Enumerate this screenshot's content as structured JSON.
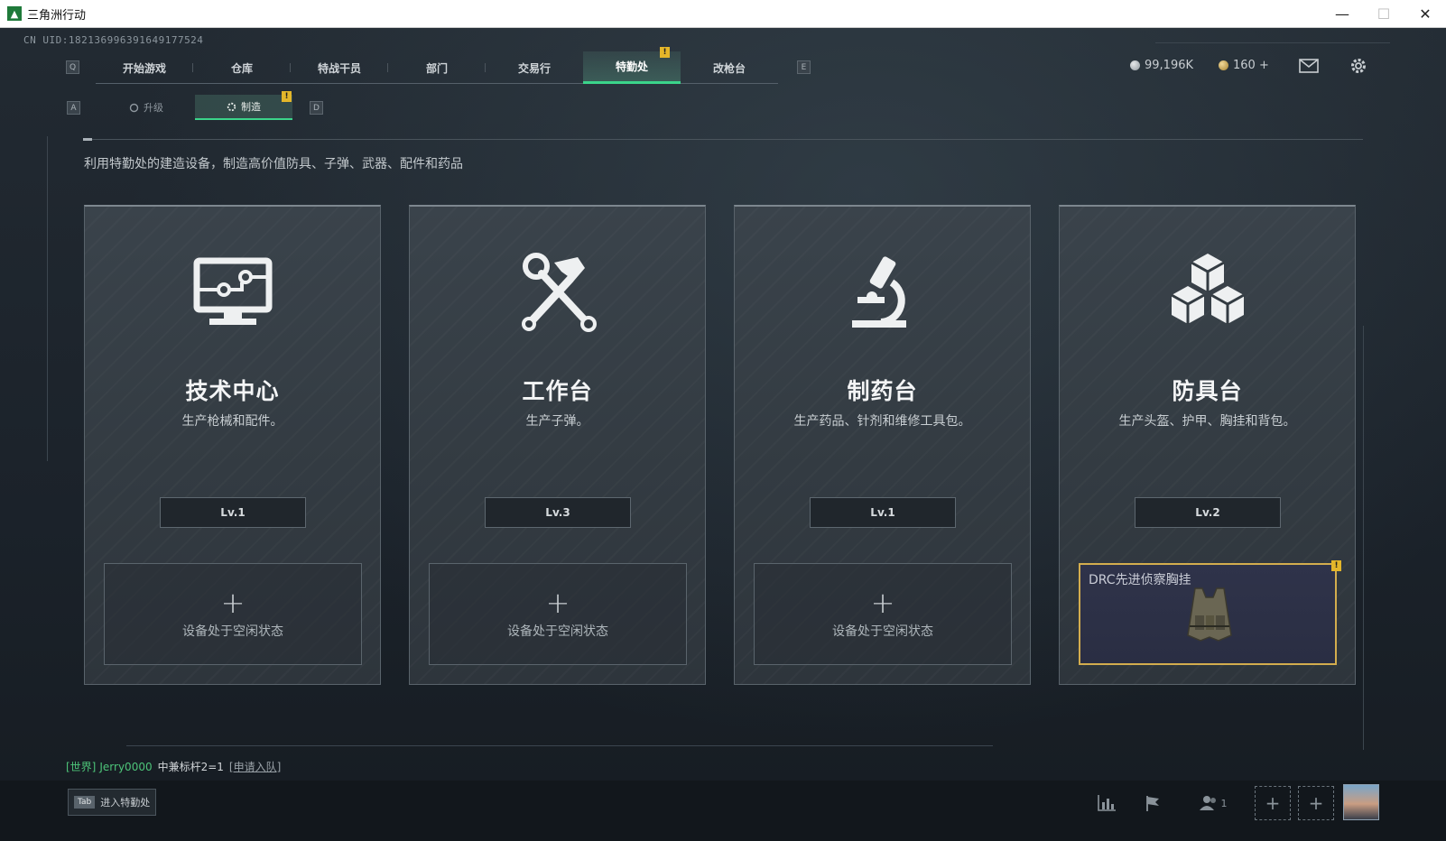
{
  "window": {
    "title": "三角洲行动",
    "minimize": "—",
    "maximize": "☐",
    "close": "✕"
  },
  "uid": "CN UID:18213699639164917752​4",
  "nav": {
    "key_left": "Q",
    "key_right": "E",
    "tabs": [
      "开始游戏",
      "仓库",
      "特战干员",
      "部门",
      "交易行",
      "特勤处",
      "改枪台"
    ],
    "active_index": 5
  },
  "status": {
    "currency1": "99,196K",
    "currency2": "160 +"
  },
  "subnav": {
    "key_left": "A",
    "key_right": "D",
    "upgrade": "升级",
    "craft": "制造"
  },
  "badge": "!",
  "description": "利用特勤处的建造设备，制造高价值防具、子弹、武器、配件和药品",
  "cards": [
    {
      "title": "技术中心",
      "subtitle": "生产枪械和配件。",
      "level": "Lv.1",
      "plus": "+",
      "idle": "设备处于空闲状态"
    },
    {
      "title": "工作台",
      "subtitle": "生产子弹。",
      "level": "Lv.3",
      "plus": "+",
      "idle": "设备处于空闲状态"
    },
    {
      "title": "制药台",
      "subtitle": "生产药品、针剂和维修工具包。",
      "level": "Lv.1",
      "plus": "+",
      "idle": "设备处于空闲状态"
    },
    {
      "title": "防具台",
      "subtitle": "生产头盔、护甲、胸挂和背包。",
      "level": "Lv.2",
      "item_name": "DRC先进侦察胸挂"
    }
  ],
  "chat": {
    "channel": "[世界]",
    "user": "Jerry0000",
    "message": "中兼标杆2=1",
    "link": "[申请入队]"
  },
  "bottom": {
    "tab_key": "Tab",
    "tab_label": "进入特勤处",
    "party_count": "1",
    "add": "+"
  },
  "colors": {
    "accent": "#3bd48a",
    "alert": "#e4b62a",
    "item_border": "#d3ad4e"
  }
}
